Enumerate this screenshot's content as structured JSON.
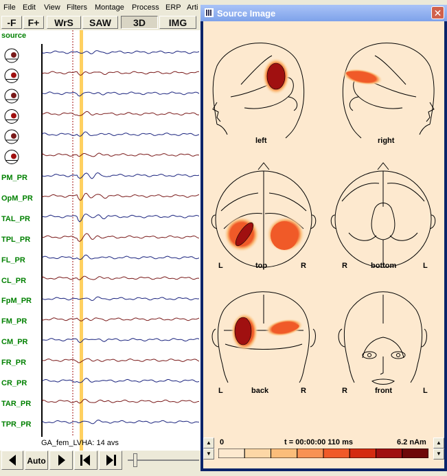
{
  "menu": [
    "File",
    "Edit",
    "View",
    "Filters",
    "Montage",
    "Process",
    "ERP",
    "Arti"
  ],
  "toolbar": {
    "minus_f": "-F",
    "plus_f": "F+",
    "wrs": "WrS",
    "saw": "SAW",
    "three_d": "3D",
    "img": "IMG"
  },
  "eeg": {
    "source_header": "source",
    "channels": [
      "PM_PR",
      "OpM_PR",
      "TAL_PR",
      "TPL_PR",
      "FL_PR",
      "CL_PR",
      "FpM_PR",
      "FM_PR",
      "CM_PR",
      "FR_PR",
      "CR_PR",
      "TAR_PR",
      "TPR_PR"
    ],
    "status": "GA_fem_LVHA: 14 avs"
  },
  "bottom": {
    "auto_label": "Auto"
  },
  "window": {
    "title": "Source Image",
    "views": {
      "left": "left",
      "right": "right",
      "top": "top",
      "bottom": "bottom",
      "back": "back",
      "front": "front",
      "L": "L",
      "R": "R"
    },
    "scale": {
      "min": "0",
      "time": "t = 00:00:00  110 ms",
      "max": "6.2 nAm"
    },
    "colorbar": [
      "#fde9cf",
      "#fcd7a6",
      "#fbbd7a",
      "#f89254",
      "#f05a28",
      "#d42c10",
      "#a01010",
      "#6e0808"
    ]
  },
  "colors": {
    "channel_label": "#008000",
    "trace_blue": "#1a237e",
    "trace_brown": "#7a1a1a",
    "cursor": "#ffd060",
    "title_gradient": "#7ea2ea"
  }
}
